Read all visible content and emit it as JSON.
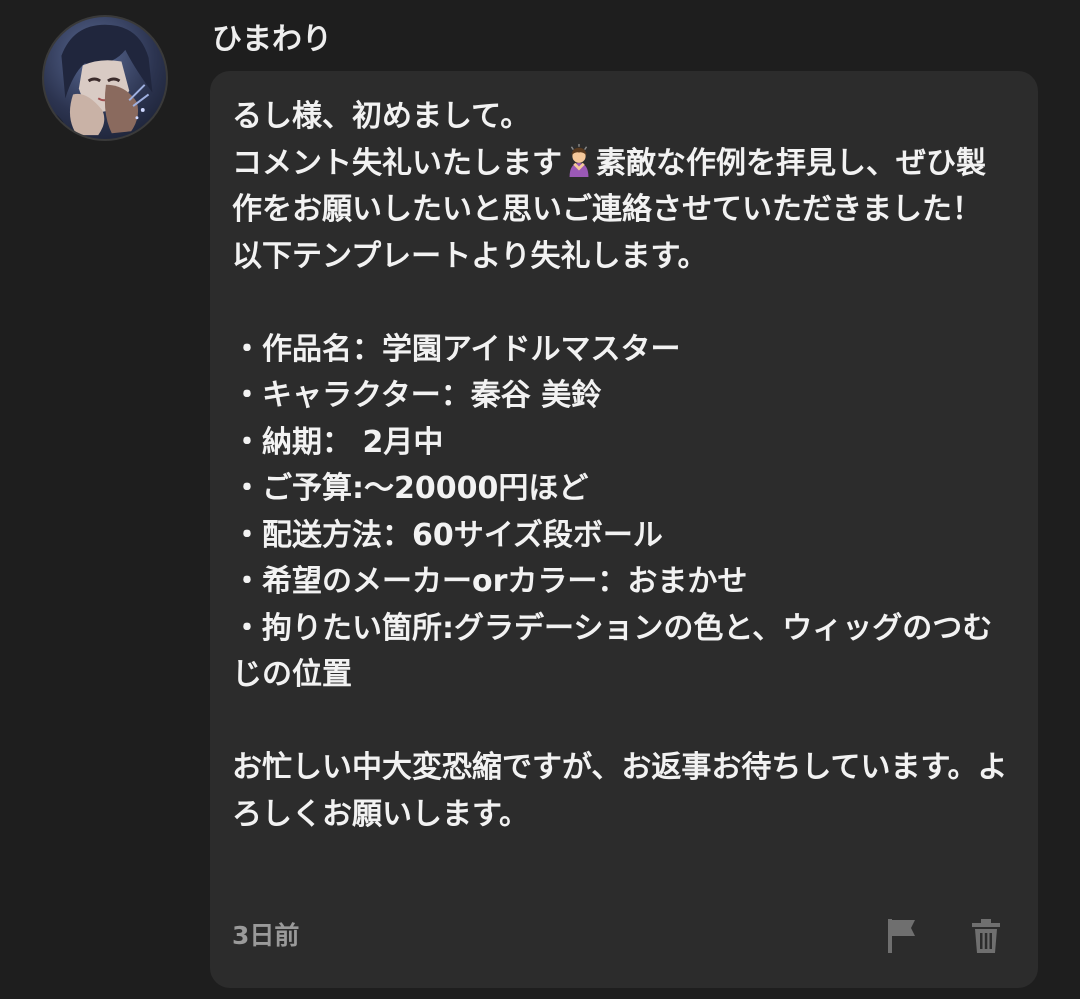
{
  "comment": {
    "username": "ひまわり",
    "avatar_icon": "user-avatar",
    "message_lines": [
      "るし様、初めまして。",
      "コメント失礼いたします",
      "素敵な作例を拝見し、ぜひ製作をお願いしたいと思いご連絡させていただきました！",
      "以下テンプレートより失礼します。",
      "",
      "・作品名：学園アイドルマスター",
      "・キャラクター：秦谷 美鈴",
      "・納期： 2月中",
      "・ご予算:〜20000円ほど",
      "・配送方法：60サイズ段ボール",
      "・希望のメーカーorカラー：おまかせ",
      "・拘りたい箇所:グラデーションの色と、ウィッグのつむじの位置",
      "",
      "お忙しい中大変恐縮ですが、お返事お待ちしています。よろしくお願いします。"
    ],
    "inline_emoji": "person-bowing-emoji",
    "timestamp": "3日前",
    "actions": {
      "report_icon": "flag-icon",
      "delete_icon": "trash-icon"
    }
  },
  "colors": {
    "background": "#1e1e1e",
    "bubble": "#2c2c2c",
    "text": "#f2f2f2",
    "muted": "#9a9a9a",
    "icon": "#6f6f6f"
  }
}
